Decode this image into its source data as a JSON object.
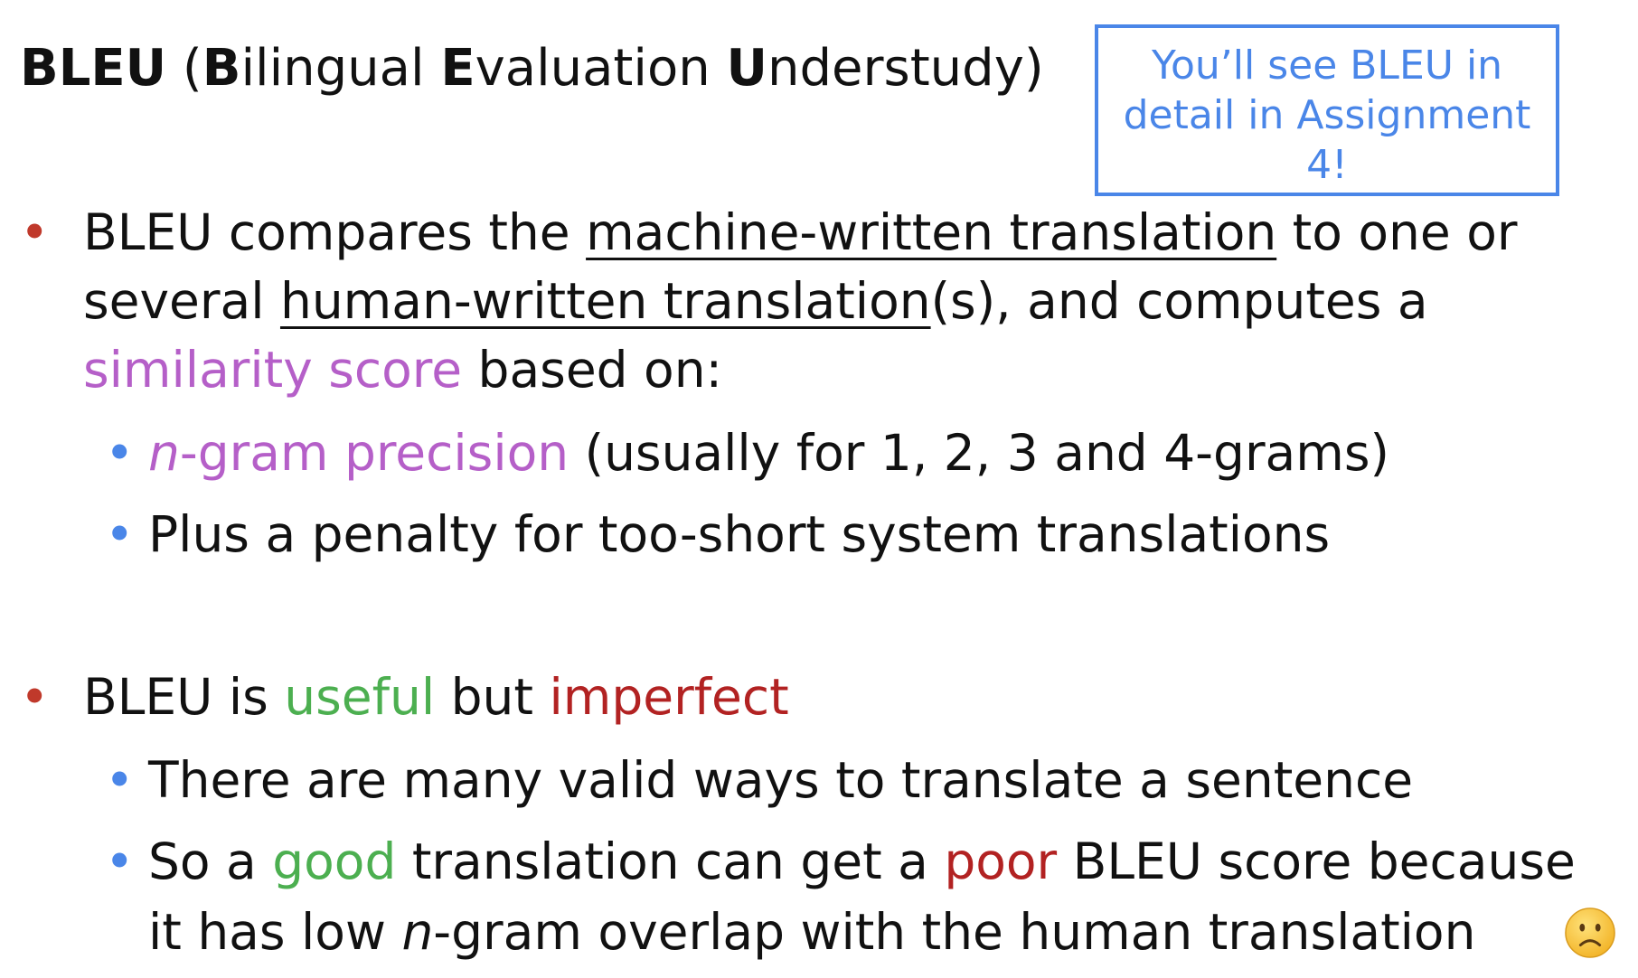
{
  "title": {
    "b1": "B",
    "t1": "LEU",
    "t2": " (",
    "b2": "B",
    "t3": "ilingual ",
    "b3": "E",
    "t4": "valuation ",
    "b4": "U",
    "t5": "nderstudy)"
  },
  "callout": {
    "line1": "You’ll see BLEU in",
    "line2": "detail in Assignment",
    "line3": "4!"
  },
  "bullet_glyph": "•",
  "section1": {
    "l1a": "BLEU compares the ",
    "l1u": "machine-written translation",
    "l1b": " to one or",
    "l2a": "several ",
    "l2u": "human-written translation",
    "l2b": "(s), and computes a",
    "l3p": "similarity score",
    "l3b": " based on:",
    "sub1_n": "n",
    "sub1_p": "-gram precision",
    "sub1_b": " (usually for 1, 2, 3 and 4-grams)",
    "sub2": "Plus a penalty for too-short system translations"
  },
  "section2": {
    "a": "BLEU is ",
    "useful": "useful",
    "b": " but ",
    "imperfect": "imperfect",
    "sub1": "There are many valid ways to translate a sentence",
    "sub2_a": "So a ",
    "good": "good",
    "sub2_b": " translation can get a ",
    "poor": "poor",
    "sub2_c": " BLEU score because",
    "sub3_a": "it has low ",
    "sub3_n": "n",
    "sub3_b": "-gram overlap with the human translation"
  },
  "colors": {
    "bullet_main": "#c0392b",
    "bullet_sub": "#4a86e8",
    "callout": "#4a86e8",
    "purple": "#b55fc8",
    "green": "#4caf50",
    "red": "#b22222"
  },
  "icons": {
    "sad_face": "frowning-face-emoji"
  }
}
